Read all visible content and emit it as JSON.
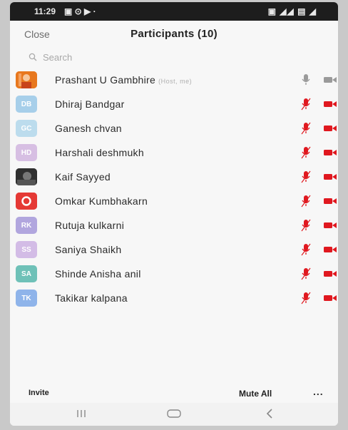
{
  "status_bar": {
    "time": "11:29",
    "left_icons": "▣ ⊙ ▶ ·",
    "right_icons": "▣ ◢◢ ▤ ◢"
  },
  "header": {
    "close_label": "Close",
    "title": "Participants (10)"
  },
  "search": {
    "placeholder": "Search"
  },
  "participants": [
    {
      "name": "Prashant U Gambhire",
      "tag": "(Host, me)",
      "avatar_initials": "",
      "avatar_type": "photo-orange",
      "avatar_color": "#e8781e",
      "mic": "gray",
      "video": "gray"
    },
    {
      "name": "Dhiraj Bandgar",
      "avatar_initials": "DB",
      "avatar_color": "#a7cfea",
      "mic": "red",
      "video": "red"
    },
    {
      "name": "Ganesh chvan",
      "avatar_initials": "GC",
      "avatar_color": "#bcdced",
      "mic": "red",
      "video": "red"
    },
    {
      "name": "Harshali deshmukh",
      "avatar_initials": "HD",
      "avatar_color": "#d7bfe3",
      "mic": "red",
      "video": "red"
    },
    {
      "name": "Kaif Sayyed",
      "avatar_initials": "",
      "avatar_type": "photo-dark",
      "avatar_color": "#3a3a3a",
      "mic": "red",
      "video": "red"
    },
    {
      "name": "Omkar Kumbhakarn",
      "avatar_initials": "O",
      "avatar_type": "logo-red",
      "avatar_color": "#e53935",
      "mic": "red",
      "video": "red"
    },
    {
      "name": "Rutuja kulkarni",
      "avatar_initials": "RK",
      "avatar_color": "#b1a6de",
      "mic": "red",
      "video": "red"
    },
    {
      "name": "Saniya Shaikh",
      "avatar_initials": "SS",
      "avatar_color": "#d3bce6",
      "mic": "red",
      "video": "red"
    },
    {
      "name": "Shinde Anisha anil",
      "avatar_initials": "SA",
      "avatar_color": "#6fc1b8",
      "mic": "red",
      "video": "red"
    },
    {
      "name": "Takikar kalpana",
      "avatar_initials": "TK",
      "avatar_color": "#8fb4ea",
      "mic": "red",
      "video": "red"
    }
  ],
  "footer": {
    "invite_label": "Invite",
    "mute_all_label": "Mute All",
    "more_label": "..."
  },
  "colors": {
    "muted_red": "#e0181f",
    "icon_gray": "#9a9a9a"
  },
  "android_nav": {
    "recents_icon": "recents-icon",
    "home_icon": "home-icon",
    "back_icon": "back-icon"
  }
}
